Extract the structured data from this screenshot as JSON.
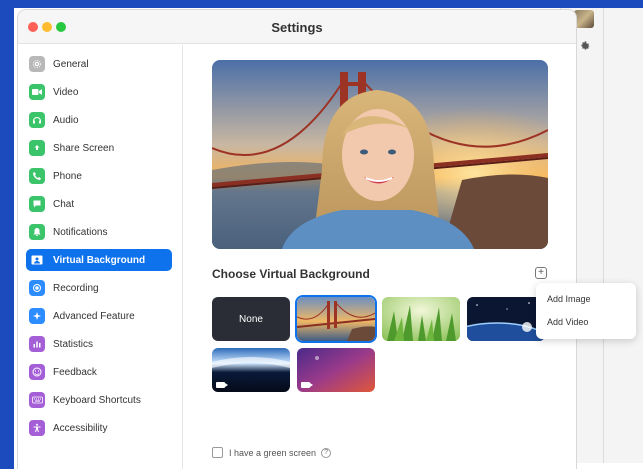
{
  "window": {
    "title": "Settings"
  },
  "sidebar": {
    "items": [
      {
        "label": "General",
        "icon": "gear-icon",
        "color": "#b8b8b8"
      },
      {
        "label": "Video",
        "icon": "video-icon",
        "color": "#3cc46a"
      },
      {
        "label": "Audio",
        "icon": "headphones-icon",
        "color": "#3cc46a"
      },
      {
        "label": "Share Screen",
        "icon": "share-screen-icon",
        "color": "#3cc46a"
      },
      {
        "label": "Phone",
        "icon": "phone-icon",
        "color": "#3cc46a"
      },
      {
        "label": "Chat",
        "icon": "chat-icon",
        "color": "#3cc46a"
      },
      {
        "label": "Notifications",
        "icon": "bell-icon",
        "color": "#3cc46a"
      },
      {
        "label": "Virtual Background",
        "icon": "virtual-background-icon",
        "color": "#0e72ed",
        "active": true
      },
      {
        "label": "Recording",
        "icon": "recording-icon",
        "color": "#2d8cff"
      },
      {
        "label": "Advanced Feature",
        "icon": "sparkle-icon",
        "color": "#2d8cff"
      },
      {
        "label": "Statistics",
        "icon": "statistics-icon",
        "color": "#a45fd6"
      },
      {
        "label": "Feedback",
        "icon": "smiley-icon",
        "color": "#a45fd6"
      },
      {
        "label": "Keyboard Shortcuts",
        "icon": "keyboard-icon",
        "color": "#a45fd6"
      },
      {
        "label": "Accessibility",
        "icon": "accessibility-icon",
        "color": "#a45fd6"
      }
    ]
  },
  "main": {
    "section_title": "Choose Virtual Background",
    "thumbnails": [
      {
        "label": "None"
      }
    ],
    "green_screen_label": "I have a green screen"
  },
  "popup": {
    "items": [
      "Add Image",
      "Add Video"
    ]
  },
  "colors": {
    "accent": "#0e72ed",
    "frame": "#1c4bbd"
  }
}
